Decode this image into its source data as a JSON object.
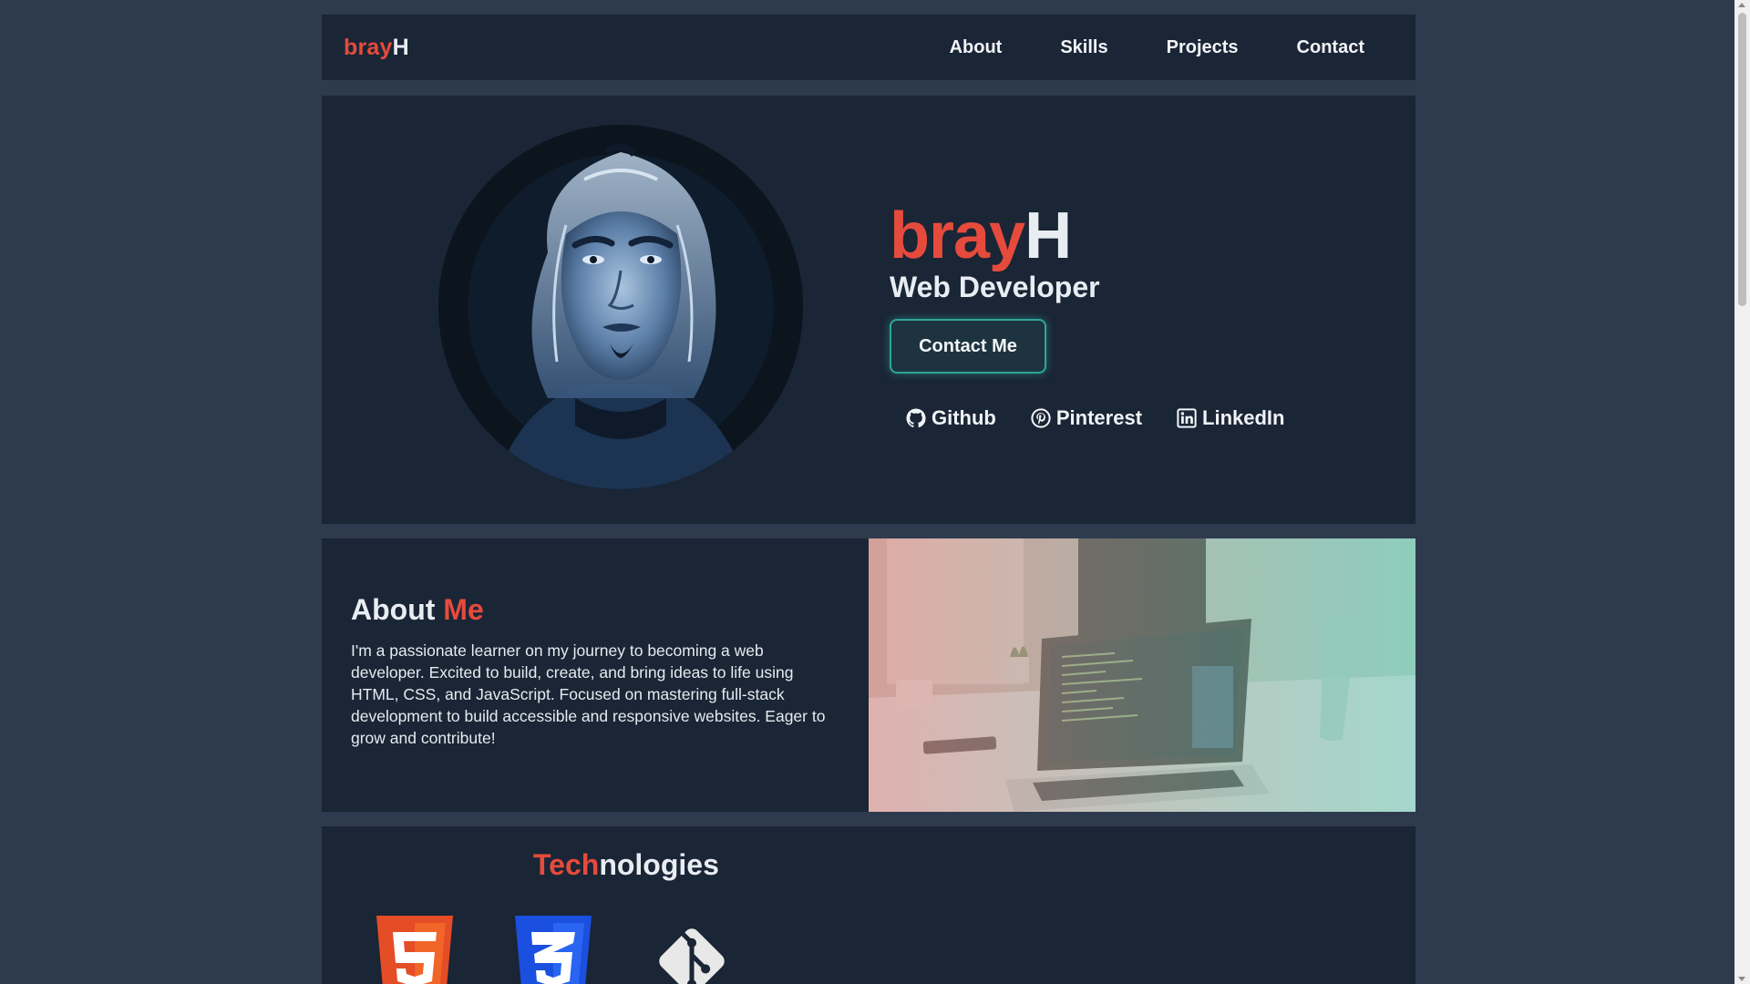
{
  "nav": {
    "logo_part1": "bray",
    "logo_part2": "H",
    "links": [
      "About",
      "Skills",
      "Projects",
      "Contact"
    ]
  },
  "hero": {
    "name_part1": "bray",
    "name_part2": "H",
    "role": "Web Developer",
    "cta_label": "Contact Me",
    "socials": [
      {
        "label": "Github",
        "icon": "github-icon"
      },
      {
        "label": "Pinterest",
        "icon": "pinterest-icon"
      },
      {
        "label": "LinkedIn",
        "icon": "linkedin-icon"
      }
    ]
  },
  "about": {
    "title_part1": "About ",
    "title_part2": "Me",
    "text": "I'm a passionate learner on my journey to becoming a web developer. Excited to build, create, and bring ideas to life using HTML, CSS, and JavaScript. Focused on mastering full-stack development to build accessible and responsive websites. Eager to grow and contribute!"
  },
  "tech": {
    "title_part1": "Tech",
    "title_part2": "nologies",
    "icons": [
      "html5-icon",
      "css3-icon",
      "git-icon"
    ]
  },
  "colors": {
    "accent": "#e54b3c",
    "page_bg": "#2e3b4e",
    "panel_bg": "#1a2535",
    "button_border": "#2ea59a"
  }
}
